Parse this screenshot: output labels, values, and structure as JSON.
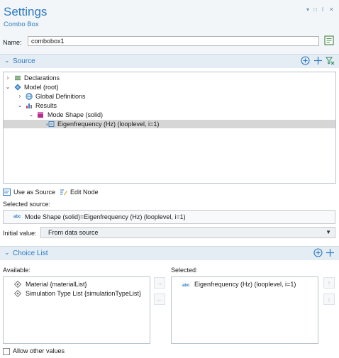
{
  "header": {
    "title": "Settings",
    "subtitle": "Combo Box",
    "controls": [
      "▾",
      "□",
      "ǀ",
      "✕"
    ]
  },
  "name_field": {
    "label": "Name:",
    "value": "combobox1"
  },
  "source": {
    "title": "Source",
    "tree": [
      {
        "label": "Declarations",
        "caret": "›",
        "icon": "declarations-icon"
      },
      {
        "label": "Model (root)",
        "caret": "⌄",
        "icon": "model-root-icon"
      },
      {
        "label": "Global Definitions",
        "caret": "›",
        "icon": "global-definitions-icon"
      },
      {
        "label": "Results",
        "caret": "⌄",
        "icon": "results-icon"
      },
      {
        "label": "Mode Shape (solid)",
        "caret": "⌄",
        "icon": "mode-shape-icon"
      },
      {
        "label": "Eigenfrequency (Hz) (looplevel, i=1)",
        "caret": "",
        "icon": "eigenfrequency-icon",
        "selected": true
      }
    ],
    "actions": {
      "use_as_source": "Use as Source",
      "edit_node": "Edit Node"
    },
    "selected_source_label": "Selected source:",
    "selected_source_abc": "abc",
    "selected_source_value": "Mode Shape (solid)=Eigenfrequency (Hz) (looplevel, i=1)",
    "initial_value_label": "Initial value:",
    "initial_value": "From data source"
  },
  "choice_list": {
    "title": "Choice List",
    "available_label": "Available:",
    "available": [
      "Material {materialList}",
      "Simulation Type List {simulationTypeList}"
    ],
    "selected_label": "Selected:",
    "selected_abc": "abc",
    "selected": [
      "Eigenfrequency (Hz) (looplevel, i=1)"
    ],
    "move_right": "→",
    "move_left": "←",
    "move_up": "↑",
    "move_down": "↓"
  },
  "allow_other_values": {
    "label": "Allow other values",
    "checked": false
  },
  "colors": {
    "accent": "#2b79c2",
    "header_bg": "#f3f6f9",
    "section_bg": "#e4ecf4",
    "selection": "#d6d6d6"
  }
}
